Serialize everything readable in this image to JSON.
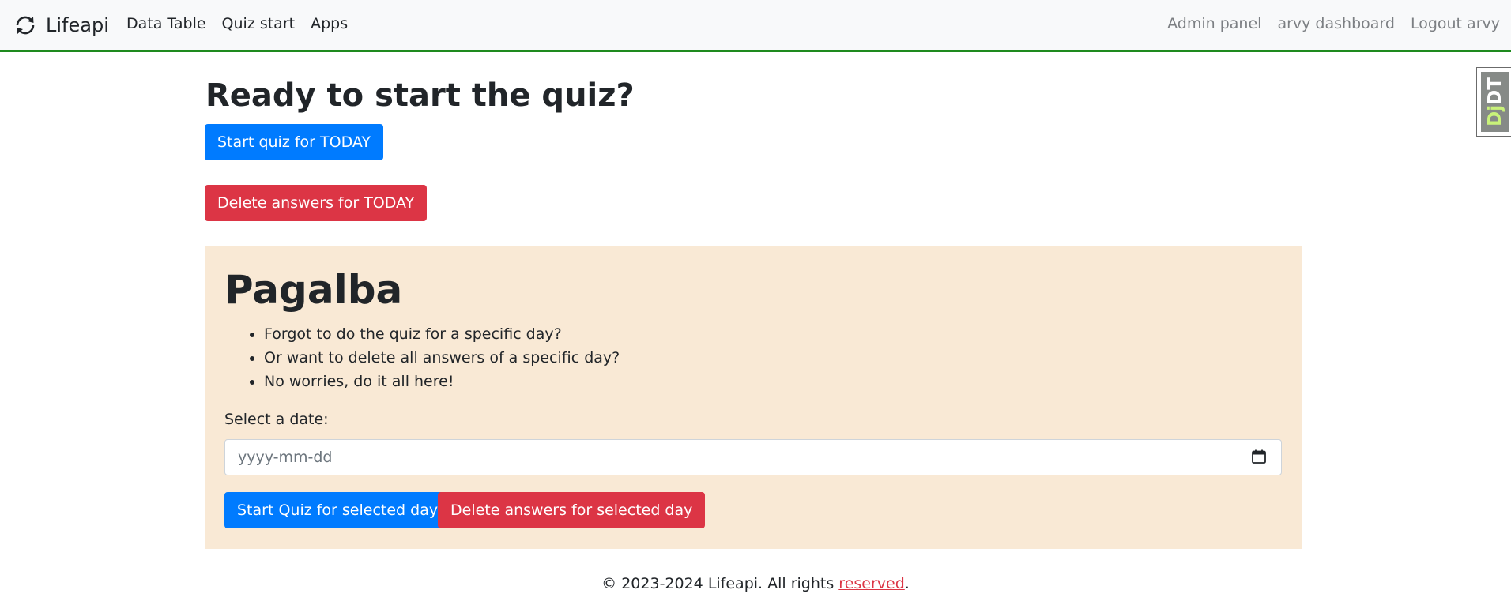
{
  "brand": {
    "name": "Lifeapi",
    "icon": "refresh-icon"
  },
  "nav": {
    "left": [
      "Data Table",
      "Quiz start",
      "Apps"
    ],
    "right": [
      "Admin panel",
      "arvy dashboard",
      "Logout arvy"
    ]
  },
  "toolbar": {
    "djdt_prefix": "Dj",
    "djdt_suffix": "DT"
  },
  "main": {
    "title": "Ready to start the quiz?",
    "start_today_label": "Start quiz for TODAY",
    "delete_today_label": "Delete answers for TODAY"
  },
  "pagalba": {
    "heading": "Pagalba",
    "bullets": [
      "Forgot to do the quiz for a specific day?",
      "Or want to delete all answers of a specific day?",
      "No worries, do it all here!"
    ],
    "date_label": "Select a date:",
    "date_placeholder": "yyyy-mm-dd",
    "start_selected_label": "Start Quiz for selected day",
    "delete_selected_label": "Delete answers for selected day"
  },
  "footer": {
    "text": "© 2023-2024 Lifeapi. All rights ",
    "link": "reserved",
    "end": "."
  },
  "colors": {
    "primary": "#007bff",
    "danger": "#dc3545",
    "navbar_border": "#1e8a1e",
    "jumbotron_bg": "#f9e9d5"
  }
}
